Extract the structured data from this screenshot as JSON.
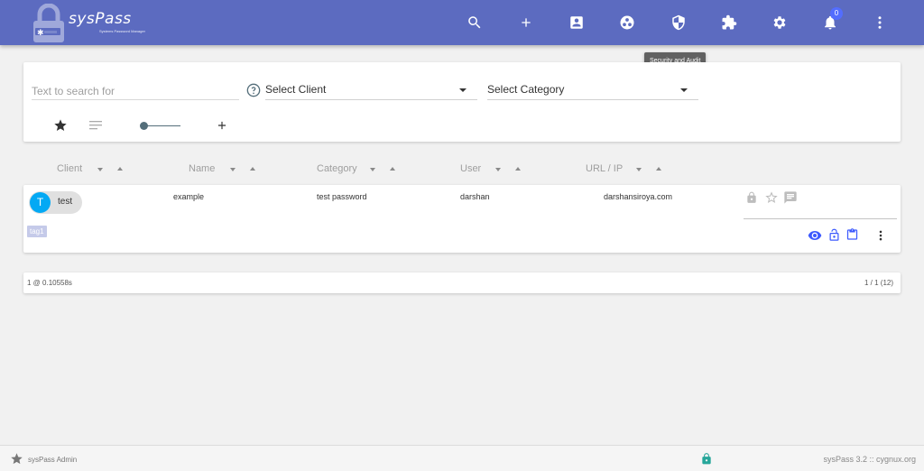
{
  "app": {
    "name": "sysPass",
    "tagline": "Systems Password Manager"
  },
  "header": {
    "icons": [
      "search-icon",
      "add-icon",
      "account-box-icon",
      "group-icon",
      "security-icon",
      "extension-icon",
      "settings-icon",
      "notifications-icon",
      "more-vert-icon"
    ],
    "notification_count": "0",
    "tooltip": "Security and Audit"
  },
  "search": {
    "placeholder": "Text to search for",
    "client_select": "Select Client",
    "category_select": "Select Category"
  },
  "table": {
    "columns": [
      "Client",
      "Name",
      "Category",
      "User",
      "URL / IP"
    ],
    "rows": [
      {
        "client_initial": "T",
        "client": "test",
        "name": "example",
        "category": "test password",
        "user": "darshan",
        "url": "darshansiroya.com",
        "tag": "tag1"
      }
    ]
  },
  "pager": {
    "timing": "1 @ 0.10558s",
    "pages": "1 / 1 (12)"
  },
  "footer": {
    "user": "sysPass Admin",
    "version": "sysPass 3.2  ::  cygnux.org"
  },
  "colors": {
    "header": "#5c6bc0",
    "accent": "#536dfe",
    "avatar": "#03a9f4",
    "tag": "#c5cae9",
    "lock_green": "#26a69a"
  }
}
